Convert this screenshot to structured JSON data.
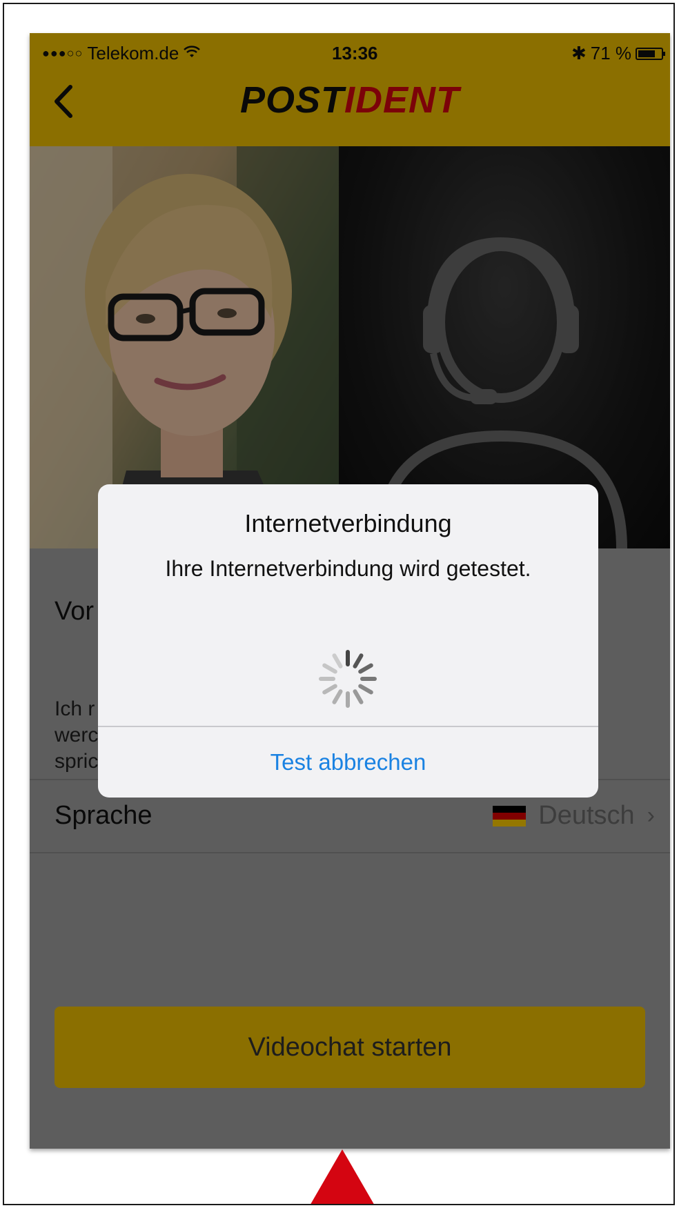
{
  "status_bar": {
    "signal": "●●●○○",
    "carrier": "Telekom.de",
    "time": "13:36",
    "bluetooth": "✱",
    "battery": "71 %"
  },
  "nav": {
    "back_icon": "chevron-left-icon",
    "logo_post": "POST",
    "logo_ident": "IDENT"
  },
  "colors": {
    "brand_yellow": "#f0c000",
    "brand_red": "#d40511",
    "alert_button_blue": "#1a82e2"
  },
  "content": {
    "section_title_visible": "Vor",
    "body_text_visible": [
      "Ich r",
      "werc",
      "spric..."
    ],
    "language_label": "Sprache",
    "language_value": "Deutsch",
    "language_chevron": "›",
    "start_button": "Videochat starten"
  },
  "alert": {
    "title": "Internetverbindung",
    "message": "Ihre Internetverbindung wird getestet.",
    "button": "Test abbrechen"
  }
}
